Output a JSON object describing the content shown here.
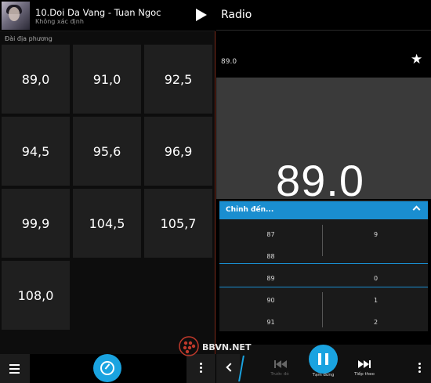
{
  "now_playing": {
    "title": "10.Doi Da Vang - Tuan Ngoc",
    "subtitle": "Không xác định",
    "play_icon": "play-icon"
  },
  "local_stations": {
    "label": "Đài địa phương",
    "stations": [
      "89,0",
      "91,0",
      "92,5",
      "94,5",
      "95,6",
      "96,9",
      "99,9",
      "104,5",
      "105,7",
      "108,0"
    ]
  },
  "left_toolbar": {
    "menu_icon": "menu-icon",
    "tune_icon": "radio-tune-icon",
    "more_icon": "more-vertical-icon"
  },
  "radio": {
    "title": "Radio",
    "current_frequency": "89.0",
    "big_frequency": "89.0",
    "favorite_icon": "star-icon"
  },
  "tune_picker": {
    "header": "Chỉnh đến...",
    "left_column": [
      "87",
      "88",
      "89",
      "90",
      "91"
    ],
    "right_column": [
      "9",
      "",
      "0",
      "1",
      "2"
    ],
    "selected_left": "89",
    "selected_right": "0"
  },
  "player_bar": {
    "prev_label": "Trước đó",
    "pause_label": "Tạm dừng",
    "next_label": "Tiếp theo"
  },
  "watermark": {
    "text": "BBVN.NET"
  },
  "colors": {
    "accent": "#1aa3e0",
    "tile": "#1f1f1f",
    "panel": "#3a3a3a"
  }
}
